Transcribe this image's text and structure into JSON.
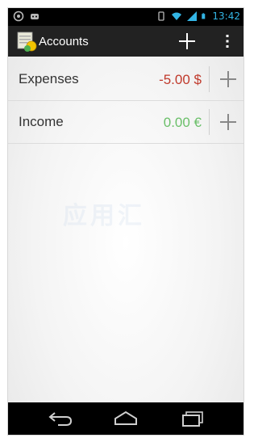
{
  "status_bar": {
    "time": "13:42",
    "left_icons": [
      "android-debug-icon",
      "notification-icon"
    ],
    "right_icons": [
      "vibrate-icon",
      "wifi-icon",
      "signal-icon",
      "battery-icon"
    ]
  },
  "action_bar": {
    "title": "Accounts",
    "app_icon": "accounts-app-icon",
    "add_icon": "plus-icon",
    "overflow_icon": "overflow-menu-icon"
  },
  "accounts": [
    {
      "name": "Expenses",
      "amount": "-5.00 $",
      "amount_color": "#c0392b"
    },
    {
      "name": "Income",
      "amount": "0.00 €",
      "amount_color": "#6abf69"
    }
  ],
  "watermark": "应用汇",
  "nav_bar": {
    "back_icon": "back-icon",
    "home_icon": "home-icon",
    "recents_icon": "recents-icon"
  },
  "colors": {
    "accent": "#33b5e5",
    "action_bar_bg": "#222222",
    "status_bar_bg": "#000000"
  }
}
